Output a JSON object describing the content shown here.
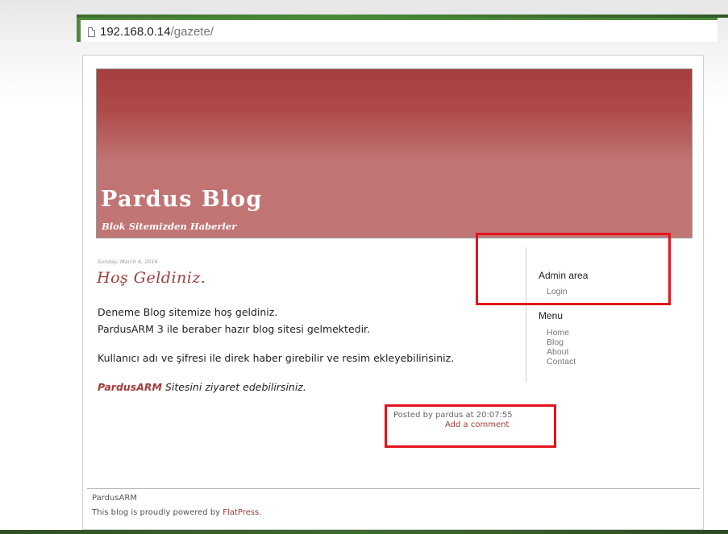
{
  "browser": {
    "url_host": "192.168.0.14",
    "url_path": "/gazete/"
  },
  "blog": {
    "title": "Pardus Blog",
    "tagline": "Blok Sitemizden Haberler"
  },
  "post": {
    "date": "Sunday, March 6, 2016",
    "title": "Hoş Geldiniz.",
    "line1": "Deneme Blog sitemize hoş geldiniz.",
    "line2": "PardusARM 3 ile beraber hazır blog sitesi gelmektedir.",
    "line3": "Kullanıcı adı ve şifresi ile direk haber girebilir ve resim ekleyebilirisiniz.",
    "link_text": "PardusARM",
    "line4_rest": " Sitesini ziyaret edebilirsiniz.",
    "posted_by": "Posted by pardus at 20:07:55",
    "add_comment": "Add a comment"
  },
  "sidebar": {
    "admin_heading": "Admin area",
    "login": "Login",
    "menu_heading": "Menu",
    "menu_items": [
      "Home",
      "Blog",
      "About",
      "Contact"
    ]
  },
  "footer": {
    "site_name": "PardusARM",
    "powered_prefix": "This blog is proudly powered by ",
    "powered_link": "FlatPress",
    "powered_suffix": "."
  },
  "colors": {
    "accent": "#a33c3c",
    "highlight": "#e3131c"
  }
}
